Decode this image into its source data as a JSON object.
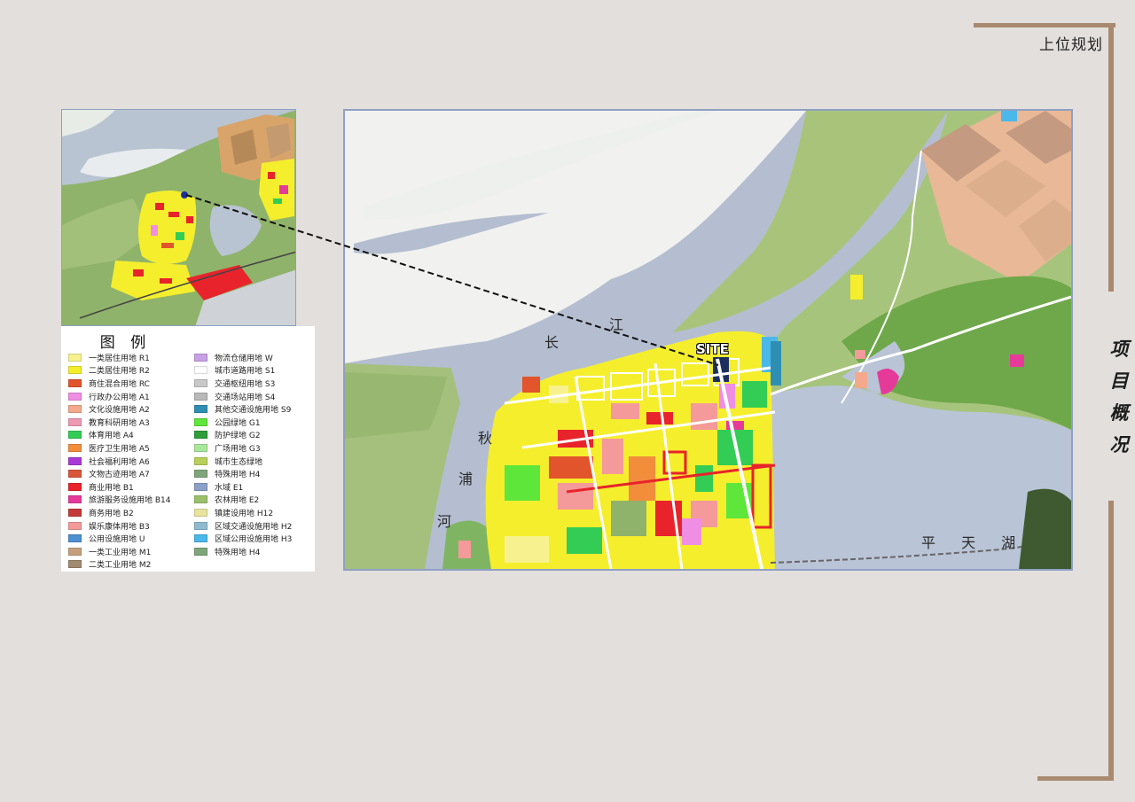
{
  "header": {
    "title": "上位规划"
  },
  "side_title": [
    "项",
    "目",
    "概",
    "况"
  ],
  "map": {
    "labels": {
      "river_changjiang_1": "长",
      "river_changjiang_2": "江",
      "river_qiupu_1": "秋",
      "river_qiupu_2": "浦",
      "river_qiupu_3": "河",
      "lake": "平 天 湖",
      "site": "SITE"
    }
  },
  "legend": {
    "title": "图 例",
    "items": [
      {
        "label": "一类居住用地  R1",
        "color": "#f7f28f"
      },
      {
        "label": "二类居住用地  R2",
        "color": "#f5ee2d"
      },
      {
        "label": "商住混合用地  RC",
        "color": "#e2542c"
      },
      {
        "label": "行政办公用地  A1",
        "color": "#ef8ee3"
      },
      {
        "label": "文化设施用地  A2",
        "color": "#f4a98c"
      },
      {
        "label": "教育科研用地  A3",
        "color": "#ee9ab4"
      },
      {
        "label": "体育用地  A4",
        "color": "#33cc55"
      },
      {
        "label": "医疗卫生用地  A5",
        "color": "#f28d3c"
      },
      {
        "label": "社会福利用地  A6",
        "color": "#a93ad6"
      },
      {
        "label": "文物古迹用地  A7",
        "color": "#d9583b"
      },
      {
        "label": "商业用地  B1",
        "color": "#e8232b"
      },
      {
        "label": "旅游服务设施用地  B14",
        "color": "#e63a9a"
      },
      {
        "label": "商务用地  B2",
        "color": "#c33a3a"
      },
      {
        "label": "娱乐康体用地  B3",
        "color": "#f49a9a"
      },
      {
        "label": "公用设施用地  U",
        "color": "#4d8fd1"
      },
      {
        "label": "一类工业用地  M1",
        "color": "#c6a07e"
      },
      {
        "label": "二类工业用地  M2",
        "color": "#a08a70"
      },
      {
        "label": "物流仓储用地  W",
        "color": "#c7a0e6"
      },
      {
        "label": "城市道路用地  S1",
        "color": "#ffffff"
      },
      {
        "label": "交通枢纽用地  S3",
        "color": "#c8c8c8"
      },
      {
        "label": "交通场站用地  S4",
        "color": "#b9b9b9"
      },
      {
        "label": "其他交通设施用地  S9",
        "color": "#2f8fb3"
      },
      {
        "label": "公园绿地  G1",
        "color": "#5ee63a"
      },
      {
        "label": "防护绿地  G2",
        "color": "#2e9e3a"
      },
      {
        "label": "广场用地  G3",
        "color": "#a8e89a"
      },
      {
        "label": "城市生态绿地",
        "color": "#b9cf5a"
      },
      {
        "label": "特殊用地  H4",
        "color": "#7fa67a"
      },
      {
        "label": "水域  E1",
        "color": "#8aa0c6"
      },
      {
        "label": "农林用地  E2",
        "color": "#9bc06a"
      },
      {
        "label": "镇建设用地  H12",
        "color": "#e8e4a0"
      },
      {
        "label": "区域交通设施用地  H2",
        "color": "#8fbad0"
      },
      {
        "label": "区域公用设施用地  H3",
        "color": "#4ab8e8"
      },
      {
        "label": "特殊用地  H4",
        "color": "#7fa67a"
      }
    ]
  }
}
